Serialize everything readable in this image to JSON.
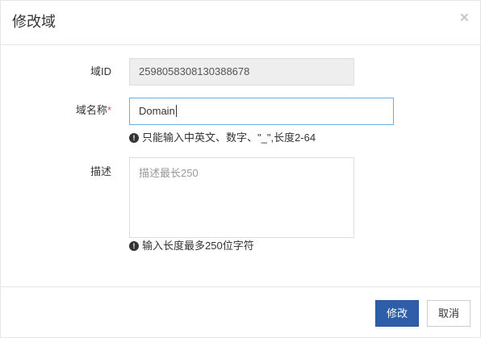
{
  "dialog": {
    "title": "修改域",
    "close_label": "×"
  },
  "form": {
    "domain_id": {
      "label": "域ID",
      "value": "2598058308130388678"
    },
    "domain_name": {
      "label": "域名称",
      "required_mark": "*",
      "value": "Domain",
      "hint": "只能输入中英文、数字、\"_\",长度2-64"
    },
    "description": {
      "label": "描述",
      "placeholder": "描述最长250",
      "hint": "输入长度最多250位字符"
    }
  },
  "footer": {
    "submit_label": "修改",
    "cancel_label": "取消"
  },
  "colors": {
    "primary": "#2e5ea8",
    "focus_border": "#66afe9",
    "required": "#d9534f",
    "readonly_bg": "#eeeeee"
  },
  "icons": {
    "close": "close-icon",
    "hint": "info-icon"
  }
}
